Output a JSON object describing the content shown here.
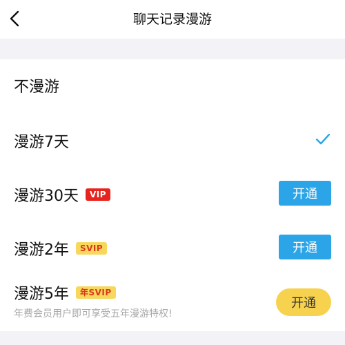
{
  "header": {
    "title": "聊天记录漫游",
    "back_icon": "chevron-left-icon"
  },
  "options": [
    {
      "label": "不漫游"
    },
    {
      "label": "漫游7天",
      "selected": true,
      "check_icon": "checkmark-icon"
    },
    {
      "label": "漫游30天",
      "badge": "VIP",
      "button": "开通"
    },
    {
      "label": "漫游2年",
      "badge": "SVIP",
      "button": "开通"
    },
    {
      "label": "漫游5年",
      "badge": "年SVIP",
      "button": "开通",
      "note": "年费会员用户即可享受五年漫游特权!"
    }
  ],
  "colors": {
    "accent_blue": "#2ca5e8",
    "vip_red": "#e8231e",
    "svip_gold": "#f7d85c",
    "open_gold": "#f7d24e",
    "check_blue": "#2ca5e8"
  }
}
